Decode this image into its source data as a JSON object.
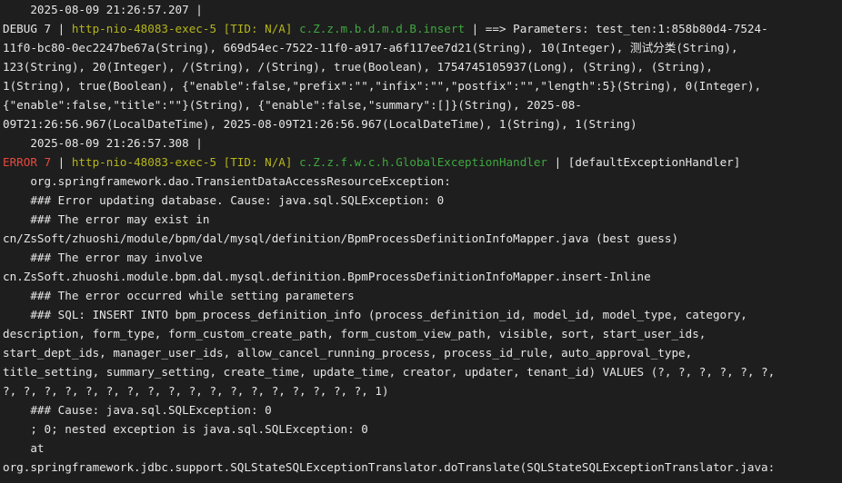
{
  "console": {
    "lines": [
      {
        "type": "plain",
        "text": "    2025-08-09 21:26:57.207 |"
      },
      {
        "type": "log",
        "level": "DEBUG 7",
        "sep1": " | ",
        "thread": "http-nio-48083-exec-5 [TID: N/A]",
        "space": " ",
        "logger": "c.Z.z.m.b.d.m.d.B.insert",
        "sep2": " | ",
        "message": "==> Parameters: test_ten:1:858b80d4-7524-"
      },
      {
        "type": "plain",
        "text": "11f0-bc80-0ec2247be67a(String), 669d54ec-7522-11f0-a917-a6f117ee7d21(String), 10(Integer), 测试分类(String),"
      },
      {
        "type": "plain",
        "text": "123(String), 20(Integer), /(String), /(String), true(Boolean), 1754745105937(Long), (String), (String),"
      },
      {
        "type": "plain",
        "text": "1(String), true(Boolean), {\"enable\":false,\"prefix\":\"\",\"infix\":\"\",\"postfix\":\"\",\"length\":5}(String), 0(Integer),"
      },
      {
        "type": "plain",
        "text": "{\"enable\":false,\"title\":\"\"}(String), {\"enable\":false,\"summary\":[]}(String), 2025-08-"
      },
      {
        "type": "plain",
        "text": "09T21:26:56.967(LocalDateTime), 2025-08-09T21:26:56.967(LocalDateTime), 1(String), 1(String)"
      },
      {
        "type": "plain",
        "text": "    2025-08-09 21:26:57.308 |"
      },
      {
        "type": "log",
        "level": "ERROR 7",
        "sep1": " | ",
        "thread": "http-nio-48083-exec-5 [TID: N/A]",
        "space": " ",
        "logger": "c.Z.z.f.w.c.h.GlobalExceptionHandler",
        "sep2": " | ",
        "message": "[defaultExceptionHandler]"
      },
      {
        "type": "plain",
        "text": "    org.springframework.dao.TransientDataAccessResourceException:"
      },
      {
        "type": "plain",
        "text": "    ### Error updating database. Cause: java.sql.SQLException: 0"
      },
      {
        "type": "plain",
        "text": "    ### The error may exist in"
      },
      {
        "type": "plain",
        "text": "cn/ZsSoft/zhuoshi/module/bpm/dal/mysql/definition/BpmProcessDefinitionInfoMapper.java (best guess)"
      },
      {
        "type": "plain",
        "text": "    ### The error may involve"
      },
      {
        "type": "plain",
        "text": "cn.ZsSoft.zhuoshi.module.bpm.dal.mysql.definition.BpmProcessDefinitionInfoMapper.insert-Inline"
      },
      {
        "type": "plain",
        "text": "    ### The error occurred while setting parameters"
      },
      {
        "type": "plain",
        "text": "    ### SQL: INSERT INTO bpm_process_definition_info (process_definition_id, model_id, model_type, category,"
      },
      {
        "type": "plain",
        "text": "description, form_type, form_custom_create_path, form_custom_view_path, visible, sort, start_user_ids,"
      },
      {
        "type": "plain",
        "text": "start_dept_ids, manager_user_ids, allow_cancel_running_process, process_id_rule, auto_approval_type,"
      },
      {
        "type": "plain",
        "text": "title_setting, summary_setting, create_time, update_time, creator, updater, tenant_id) VALUES (?, ?, ?, ?, ?, ?,"
      },
      {
        "type": "plain",
        "text": "?, ?, ?, ?, ?, ?, ?, ?, ?, ?, ?, ?, ?, ?, ?, ?, ?, ?, 1)"
      },
      {
        "type": "plain",
        "text": "    ### Cause: java.sql.SQLException: 0"
      },
      {
        "type": "plain",
        "text": "    ; 0; nested exception is java.sql.SQLException: 0"
      },
      {
        "type": "plain",
        "text": "    at"
      },
      {
        "type": "plain",
        "text": "org.springframework.jdbc.support.SQLStateSQLExceptionTranslator.doTranslate(SQLStateSQLExceptionTranslator.java:"
      }
    ]
  },
  "colors": {
    "background": "#1e1e1e",
    "text": "#e6e6e6",
    "error": "#e8483e",
    "thread": "#b5b51c",
    "logger": "#3fa83f"
  }
}
